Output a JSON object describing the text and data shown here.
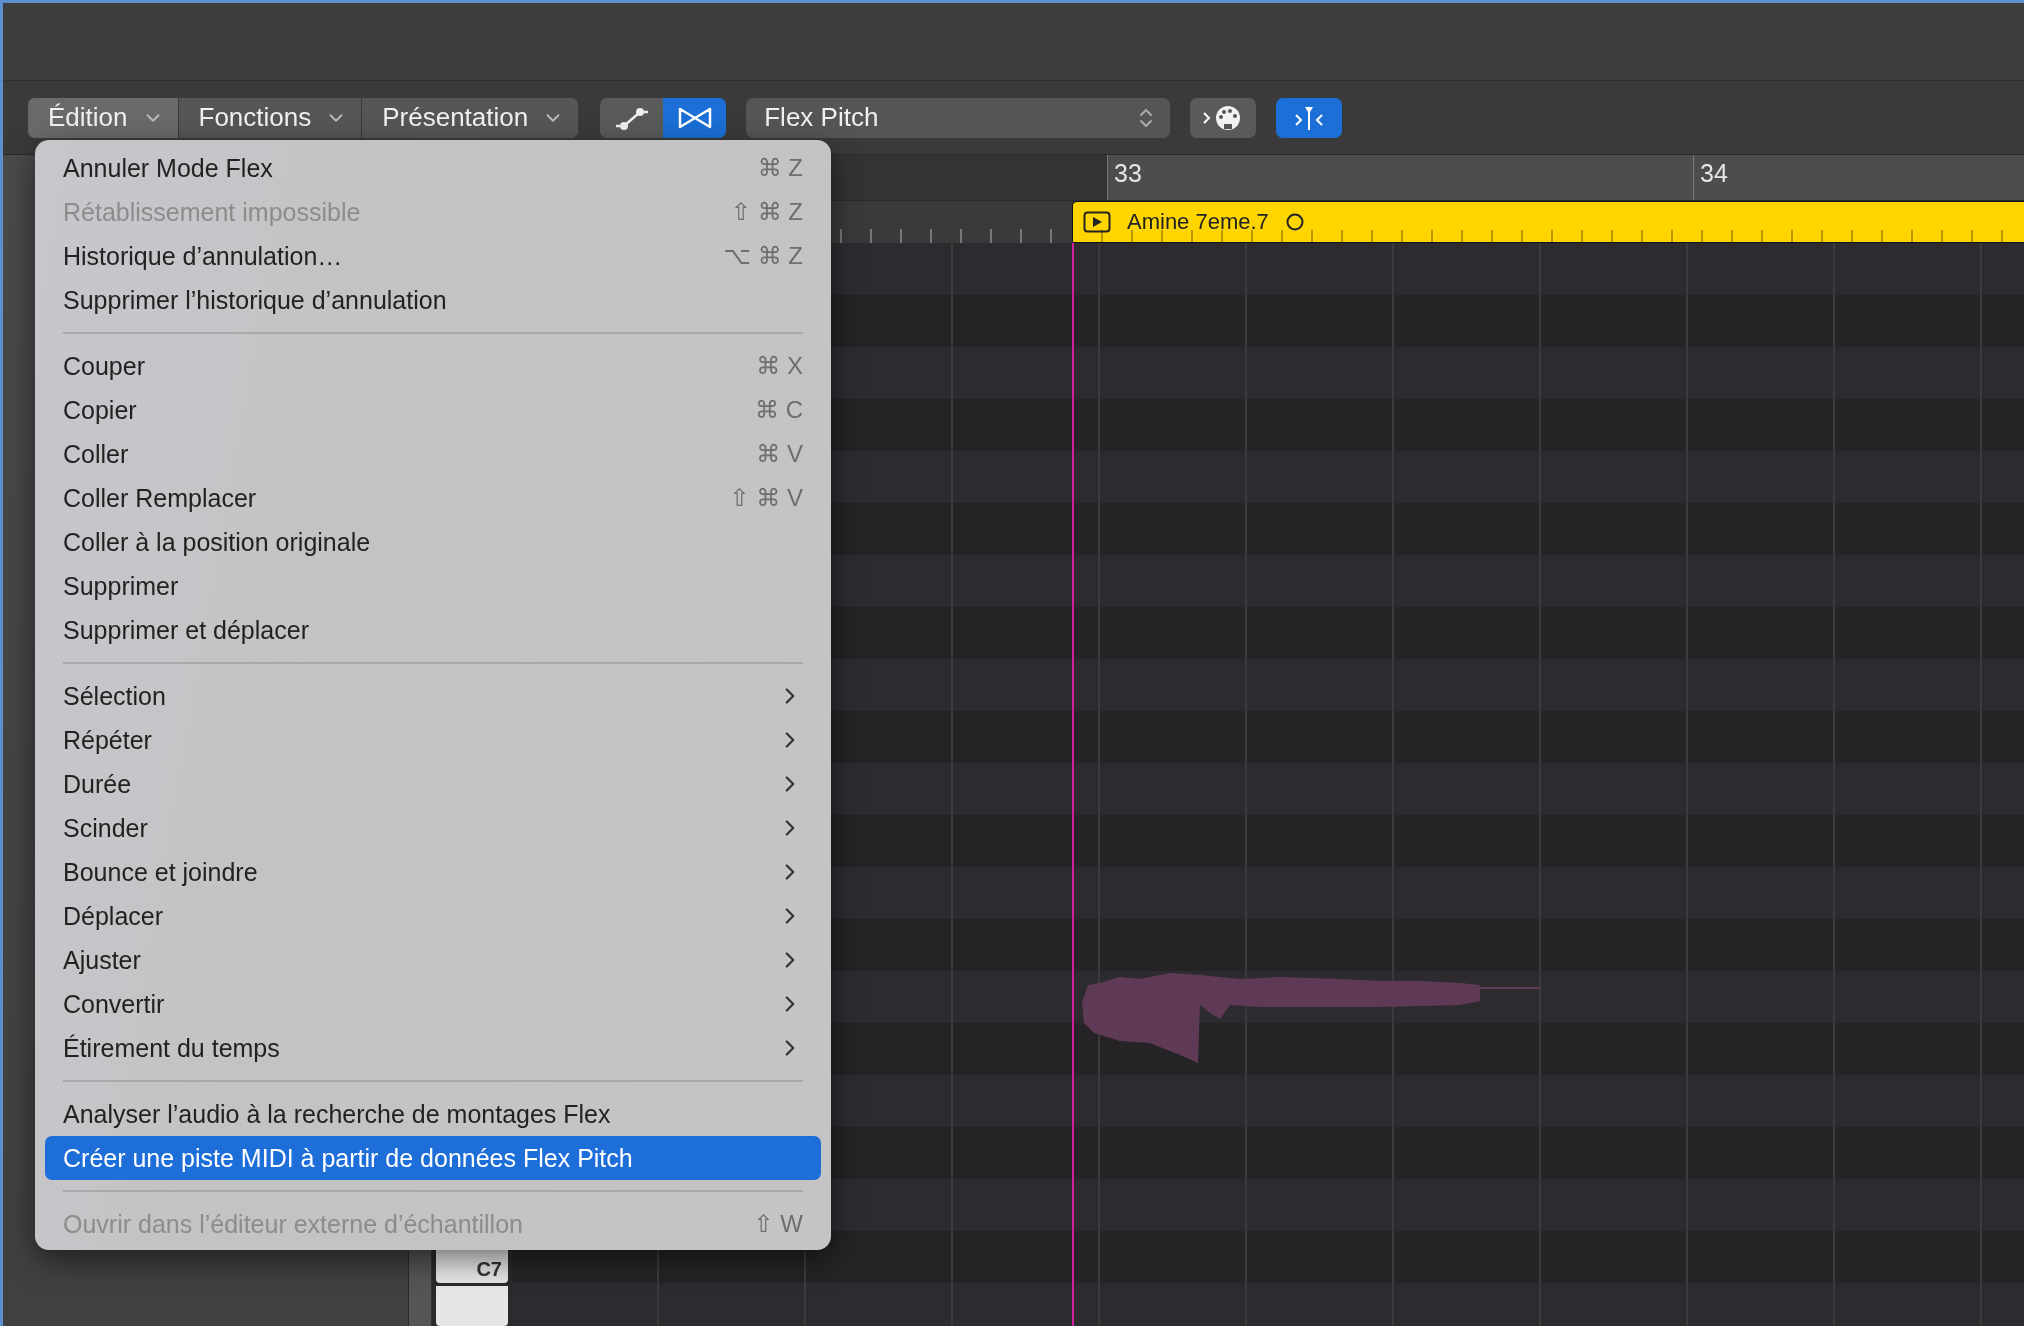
{
  "toolbar": {
    "menus": [
      {
        "label": "Édition",
        "selected": true
      },
      {
        "label": "Fonctions",
        "selected": false
      },
      {
        "label": "Présentation",
        "selected": false
      }
    ],
    "tools": [
      {
        "kind": "curve",
        "selected": false
      },
      {
        "kind": "flex",
        "selected": true
      }
    ],
    "flex_mode": {
      "value": "Flex Pitch"
    },
    "actions": [
      {
        "kind": "midi",
        "selected": false
      },
      {
        "kind": "catch",
        "selected": true
      }
    ]
  },
  "ruler": {
    "bars": [
      "33",
      "34"
    ]
  },
  "region": {
    "name": "Amine 7eme.7"
  },
  "keyboard": {
    "label": "C7"
  },
  "edit_menu": {
    "items": [
      {
        "kind": "item",
        "label": "Annuler Mode Flex",
        "shortcut": "⌘ Z",
        "disabled": false,
        "selected": false
      },
      {
        "kind": "item",
        "label": "Rétablissement impossible",
        "shortcut": "⇧ ⌘ Z",
        "disabled": true,
        "selected": false
      },
      {
        "kind": "item",
        "label": "Historique d’annulation…",
        "shortcut": "⌥ ⌘ Z",
        "disabled": false,
        "selected": false
      },
      {
        "kind": "item",
        "label": "Supprimer l’historique d’annulation",
        "disabled": false,
        "selected": false
      },
      {
        "kind": "separator"
      },
      {
        "kind": "item",
        "label": "Couper",
        "shortcut": "⌘ X",
        "disabled": false,
        "selected": false
      },
      {
        "kind": "item",
        "label": "Copier",
        "shortcut": "⌘ C",
        "disabled": false,
        "selected": false
      },
      {
        "kind": "item",
        "label": "Coller",
        "shortcut": "⌘ V",
        "disabled": false,
        "selected": false
      },
      {
        "kind": "item",
        "label": "Coller Remplacer",
        "shortcut": "⇧ ⌘ V",
        "disabled": false,
        "selected": false
      },
      {
        "kind": "item",
        "label": "Coller à la position originale",
        "disabled": false,
        "selected": false
      },
      {
        "kind": "item",
        "label": "Supprimer",
        "disabled": false,
        "selected": false
      },
      {
        "kind": "item",
        "label": "Supprimer et déplacer",
        "disabled": false,
        "selected": false
      },
      {
        "kind": "separator"
      },
      {
        "kind": "submenu",
        "label": "Sélection",
        "disabled": false,
        "selected": false
      },
      {
        "kind": "submenu",
        "label": "Répéter",
        "disabled": false,
        "selected": false
      },
      {
        "kind": "submenu",
        "label": "Durée",
        "disabled": false,
        "selected": false
      },
      {
        "kind": "submenu",
        "label": "Scinder",
        "disabled": false,
        "selected": false
      },
      {
        "kind": "submenu",
        "label": "Bounce et joindre",
        "disabled": false,
        "selected": false
      },
      {
        "kind": "submenu",
        "label": "Déplacer",
        "disabled": false,
        "selected": false
      },
      {
        "kind": "submenu",
        "label": "Ajuster",
        "disabled": false,
        "selected": false
      },
      {
        "kind": "submenu",
        "label": "Convertir",
        "disabled": false,
        "selected": false
      },
      {
        "kind": "submenu",
        "label": "Étirement du temps",
        "disabled": false,
        "selected": false
      },
      {
        "kind": "separator"
      },
      {
        "kind": "item",
        "label": "Analyser l’audio à la recherche de montages Flex",
        "disabled": false,
        "selected": false
      },
      {
        "kind": "item",
        "label": "Créer une piste MIDI à partir de données Flex Pitch",
        "disabled": false,
        "selected": true
      },
      {
        "kind": "separator"
      },
      {
        "kind": "item",
        "label": "Ouvrir dans l’éditeur externe d’échantillon",
        "shortcut": "⇧ W",
        "disabled": true,
        "selected": false
      }
    ]
  }
}
